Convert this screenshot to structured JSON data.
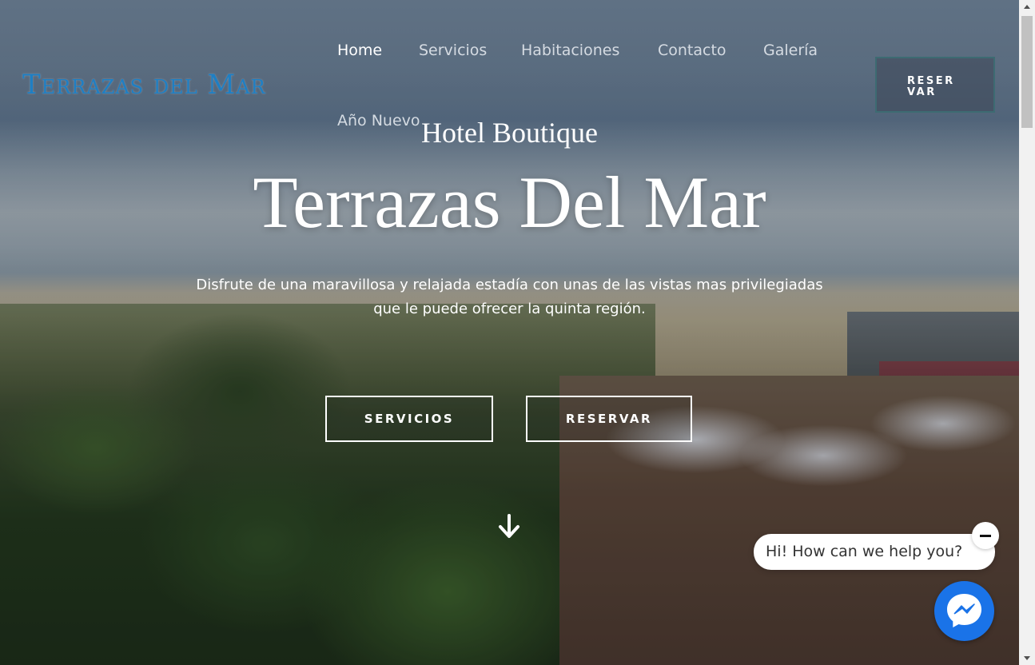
{
  "brand": {
    "logo_text": "Terrazas del Mar"
  },
  "nav": {
    "items": [
      {
        "label": "Home",
        "active": true
      },
      {
        "label": "Servicios"
      },
      {
        "label": "Habitaciones"
      },
      {
        "label": "Contacto"
      },
      {
        "label": "Galería"
      },
      {
        "label": "Año Nuevo"
      }
    ],
    "reserve_label": "RESERVAR"
  },
  "hero": {
    "subtitle": "Hotel Boutique",
    "title": "Terrazas Del Mar",
    "description_line1": "Disfrute de una maravillosa y relajada estadía con unas de las vistas mas privilegiadas",
    "description_line2": "que le puede ofrecer la quinta región.",
    "buttons": {
      "services": "SERVICIOS",
      "reserve": "RESERVAR"
    },
    "scroll_icon": "arrow-down-icon"
  },
  "chat": {
    "greeting": "Hi! How can we help you?",
    "close_icon": "minus-icon",
    "launcher_icon": "messenger-icon"
  },
  "colors": {
    "logo": "#1e7fc4",
    "messenger": "#1a73e8",
    "reserve_border": "#3d6b72"
  }
}
